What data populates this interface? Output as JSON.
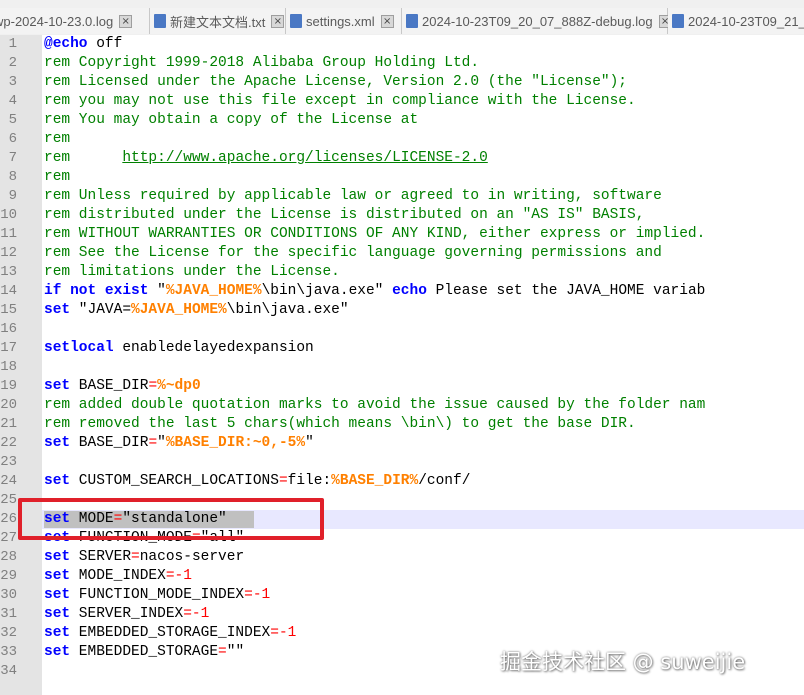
{
  "tabs": [
    {
      "label": "wp-2024-10-23.0.log",
      "icon": "log-file-icon",
      "active": false
    },
    {
      "label": "新建文本文档.txt",
      "icon": "text-file-icon",
      "active": false
    },
    {
      "label": "settings.xml",
      "icon": "xml-file-icon",
      "active": false
    },
    {
      "label": "2024-10-23T09_20_07_888Z-debug.log",
      "icon": "log-file-icon",
      "active": false
    },
    {
      "label": "2024-10-23T09_21_",
      "icon": "log-file-icon",
      "active": false
    }
  ],
  "line_numbers": [
    "1",
    "2",
    "3",
    "4",
    "5",
    "6",
    "7",
    "8",
    "9",
    "10",
    "11",
    "12",
    "13",
    "14",
    "15",
    "16",
    "17",
    "18",
    "19",
    "20",
    "21",
    "22",
    "23",
    "24",
    "25",
    "26",
    "27",
    "28",
    "29",
    "30",
    "31",
    "32",
    "33",
    "34"
  ],
  "lines": [
    [
      {
        "t": "@echo",
        "c": "kw"
      },
      {
        "t": " off",
        "c": ""
      }
    ],
    [
      {
        "t": "rem Copyright 1999-2018 Alibaba Group Holding Ltd.",
        "c": "cm"
      }
    ],
    [
      {
        "t": "rem Licensed under the Apache License, Version 2.0 (the \"License\");",
        "c": "cm"
      }
    ],
    [
      {
        "t": "rem you may not use this file except in compliance with the License.",
        "c": "cm"
      }
    ],
    [
      {
        "t": "rem You may obtain a copy of the License at",
        "c": "cm"
      }
    ],
    [
      {
        "t": "rem",
        "c": "cm"
      }
    ],
    [
      {
        "t": "rem      ",
        "c": "cm"
      },
      {
        "t": "http://www.apache.org/licenses/LICENSE-2.0",
        "c": "url"
      }
    ],
    [
      {
        "t": "rem",
        "c": "cm"
      }
    ],
    [
      {
        "t": "rem Unless required by applicable law or agreed to in writing, software",
        "c": "cm"
      }
    ],
    [
      {
        "t": "rem distributed under the License is distributed on an \"AS IS\" BASIS,",
        "c": "cm"
      }
    ],
    [
      {
        "t": "rem WITHOUT WARRANTIES OR CONDITIONS OF ANY KIND, either express or implied.",
        "c": "cm"
      }
    ],
    [
      {
        "t": "rem See the License for the specific language governing permissions and",
        "c": "cm"
      }
    ],
    [
      {
        "t": "rem limitations under the License.",
        "c": "cm"
      }
    ],
    [
      {
        "t": "if",
        "c": "kw"
      },
      {
        "t": " ",
        "c": ""
      },
      {
        "t": "not",
        "c": "kw"
      },
      {
        "t": " ",
        "c": ""
      },
      {
        "t": "exist",
        "c": "kw"
      },
      {
        "t": " \"",
        "c": ""
      },
      {
        "t": "%JAVA_HOME%",
        "c": "var"
      },
      {
        "t": "\\bin\\java.exe\" ",
        "c": ""
      },
      {
        "t": "echo",
        "c": "kw"
      },
      {
        "t": " Please set the JAVA_HOME variab",
        "c": ""
      }
    ],
    [
      {
        "t": "set",
        "c": "kw"
      },
      {
        "t": " \"JAVA=",
        "c": ""
      },
      {
        "t": "%JAVA_HOME%",
        "c": "var"
      },
      {
        "t": "\\bin\\java.exe\"",
        "c": ""
      }
    ],
    [],
    [
      {
        "t": "setlocal",
        "c": "kw"
      },
      {
        "t": " enabledelayedexpansion",
        "c": ""
      }
    ],
    [],
    [
      {
        "t": "set",
        "c": "kw"
      },
      {
        "t": " BASE_DIR",
        "c": ""
      },
      {
        "t": "=",
        "c": "op"
      },
      {
        "t": "%~dp0",
        "c": "var"
      }
    ],
    [
      {
        "t": "rem added double quotation marks to avoid the issue caused by the folder nam",
        "c": "cm"
      }
    ],
    [
      {
        "t": "rem removed the last 5 chars(which means \\bin\\) to get the base DIR.",
        "c": "cm"
      }
    ],
    [
      {
        "t": "set",
        "c": "kw"
      },
      {
        "t": " BASE_DIR",
        "c": ""
      },
      {
        "t": "=",
        "c": "op"
      },
      {
        "t": "\"",
        "c": ""
      },
      {
        "t": "%BASE_DIR:~0,-5%",
        "c": "var"
      },
      {
        "t": "\"",
        "c": ""
      }
    ],
    [],
    [
      {
        "t": "set",
        "c": "kw"
      },
      {
        "t": " CUSTOM_SEARCH_LOCATIONS",
        "c": ""
      },
      {
        "t": "=",
        "c": "op"
      },
      {
        "t": "file:",
        "c": ""
      },
      {
        "t": "%BASE_DIR%",
        "c": "var"
      },
      {
        "t": "/conf/",
        "c": ""
      }
    ],
    [],
    [
      {
        "t": "set",
        "c": "kw"
      },
      {
        "t": " MODE",
        "c": ""
      },
      {
        "t": "=",
        "c": "op"
      },
      {
        "t": "\"standalone\"",
        "c": ""
      }
    ],
    [
      {
        "t": "set",
        "c": "kw"
      },
      {
        "t": " FUNCTION_MODE",
        "c": ""
      },
      {
        "t": "=",
        "c": "op"
      },
      {
        "t": "\"all\"",
        "c": ""
      }
    ],
    [
      {
        "t": "set",
        "c": "kw"
      },
      {
        "t": " SERVER",
        "c": ""
      },
      {
        "t": "=",
        "c": "op"
      },
      {
        "t": "nacos-server",
        "c": ""
      }
    ],
    [
      {
        "t": "set",
        "c": "kw"
      },
      {
        "t": " MODE_INDEX",
        "c": ""
      },
      {
        "t": "=-1",
        "c": "op"
      }
    ],
    [
      {
        "t": "set",
        "c": "kw"
      },
      {
        "t": " FUNCTION_MODE_INDEX",
        "c": ""
      },
      {
        "t": "=-1",
        "c": "op"
      }
    ],
    [
      {
        "t": "set",
        "c": "kw"
      },
      {
        "t": " SERVER_INDEX",
        "c": ""
      },
      {
        "t": "=-1",
        "c": "op"
      }
    ],
    [
      {
        "t": "set",
        "c": "kw"
      },
      {
        "t": " EMBEDDED_STORAGE_INDEX",
        "c": ""
      },
      {
        "t": "=-1",
        "c": "op"
      }
    ],
    [
      {
        "t": "set",
        "c": "kw"
      },
      {
        "t": " EMBEDDED_STORAGE",
        "c": ""
      },
      {
        "t": "=",
        "c": "op"
      },
      {
        "t": "\"\"",
        "c": ""
      }
    ],
    []
  ],
  "current_line": 26,
  "selected_line": 26,
  "highlighted_line": 26,
  "watermark": "掘金技术社区 @ suweijie",
  "colors": {
    "keyword": "#0000ff",
    "comment": "#008000",
    "operator": "#ff0000",
    "variable": "#ff8000",
    "current_line_bg": "#e8e8ff",
    "highlight_box": "#e0202a"
  }
}
